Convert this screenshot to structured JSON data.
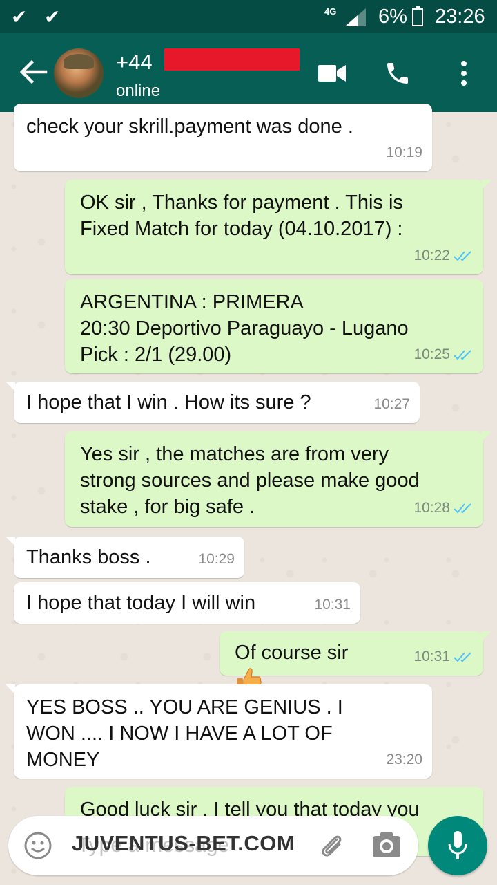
{
  "status_bar": {
    "network": "4G",
    "battery": "6%",
    "time": "23:26"
  },
  "header": {
    "contact_name": "+44",
    "status": "online"
  },
  "messages": [
    {
      "direction": "in",
      "text": "check your skrill.payment was done .",
      "time": "10:19"
    },
    {
      "direction": "out",
      "text": "OK sir , Thanks for payment . This is\nFixed Match for today (04.10.2017) :",
      "time": "10:22",
      "read": true
    },
    {
      "direction": "out",
      "text": "ARGENTINA : PRIMERA\n20:30 Deportivo Paraguayo - Lugano\nPick : 2/1 (29.00)",
      "time": "10:25",
      "read": true
    },
    {
      "direction": "in",
      "text": "I hope that I win . How its sure ?",
      "time": "10:27"
    },
    {
      "direction": "out",
      "text": "Yes sir , the matches are from very\nstrong sources and please make good\nstake , for big safe .",
      "time": "10:28",
      "read": true
    },
    {
      "direction": "in",
      "text": "Thanks boss .",
      "time": "10:29"
    },
    {
      "direction": "in",
      "text": "I hope that today I will win",
      "time": "10:31"
    },
    {
      "direction": "out",
      "text": "Of course sir",
      "time": "10:31",
      "read": true,
      "emoji": "thumbs-up"
    },
    {
      "direction": "in",
      "text": "YES BOSS .. YOU ARE GENIUS . I\nWON .... I NOW I HAVE A LOT OF\nMONEY",
      "time": "23:20"
    },
    {
      "direction": "out",
      "text": "Good luck sir . I tell you that today you",
      "time": ""
    }
  ],
  "input": {
    "placeholder": "Type a message",
    "watermark": "JUVENTUS-BET.COM"
  },
  "colors": {
    "header": "#075e54",
    "status_bar": "#054d44",
    "outgoing_bubble": "#dcf8c6",
    "incoming_bubble": "#ffffff",
    "mic_button": "#00897b",
    "read_ticks": "#4fc3f7"
  }
}
